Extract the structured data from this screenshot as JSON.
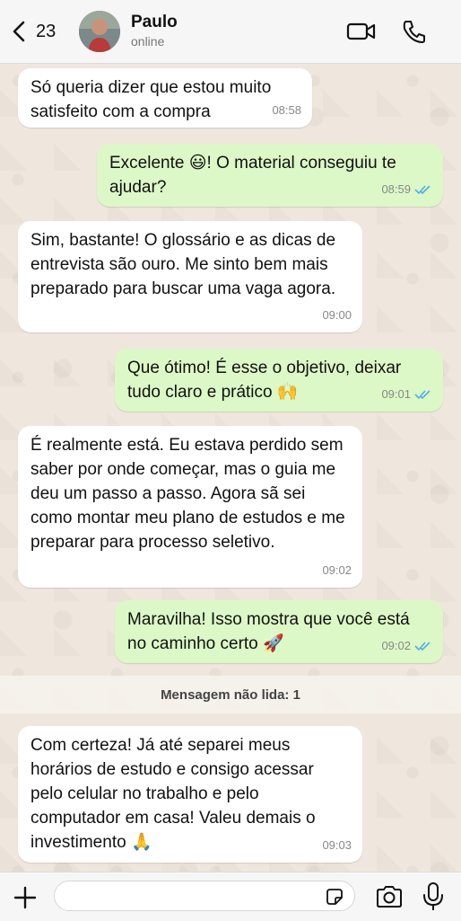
{
  "header": {
    "back_count": "23",
    "contact_name": "Paulo",
    "status": "online"
  },
  "messages": [
    {
      "dir": "in",
      "text": "Só queria dizer que estou muito satisfeito com a compra",
      "time": "08:58"
    },
    {
      "dir": "out",
      "text_a": "Excelente ",
      "emoji": "😃",
      "text_b": "! O material conseguiu te ajudar?",
      "time": "08:59",
      "read": true
    },
    {
      "dir": "in",
      "text": "Sim, bastante! O glossário e as dicas de entrevista são ouro. Me sinto bem mais preparado para buscar uma vaga agora.",
      "time": "09:00"
    },
    {
      "dir": "out",
      "text": "Que ótimo! É esse o objetivo, deixar tudo claro e prático ",
      "emoji": "🙌",
      "time": "09:01",
      "read": true
    },
    {
      "dir": "in",
      "text": "É realmente está. Eu estava perdido sem saber por onde começar, mas o guia me deu um passo a passo. Agora sã sei como montar meu plano de estudos e me preparar para processo seletivo.",
      "time": "09:02"
    },
    {
      "dir": "out",
      "text": "Maravilha! Isso mostra que você está no caminho certo ",
      "emoji": "🚀",
      "time": "09:02",
      "read": true
    },
    {
      "dir": "in",
      "text": "Com certeza! Já até separei meus horários de estudo e consigo acessar pelo celular no trabalho e pelo computador em casa! Valeu demais o investimento ",
      "emoji": "🙏",
      "time": "09:03"
    }
  ],
  "unread_banner": "Mensagem não lida: 1",
  "composer": {
    "value": "",
    "placeholder": ""
  },
  "icons": {
    "back": "chevron-left-icon",
    "video": "video-camera-icon",
    "call": "phone-icon",
    "attach": "plus-icon",
    "sticker": "sticker-icon",
    "camera": "camera-icon",
    "mic": "microphone-icon"
  },
  "colors": {
    "outgoing_bubble": "#dcf8c6",
    "incoming_bubble": "#ffffff",
    "read_ticks": "#4fb0e6",
    "background": "#efe7dd"
  }
}
